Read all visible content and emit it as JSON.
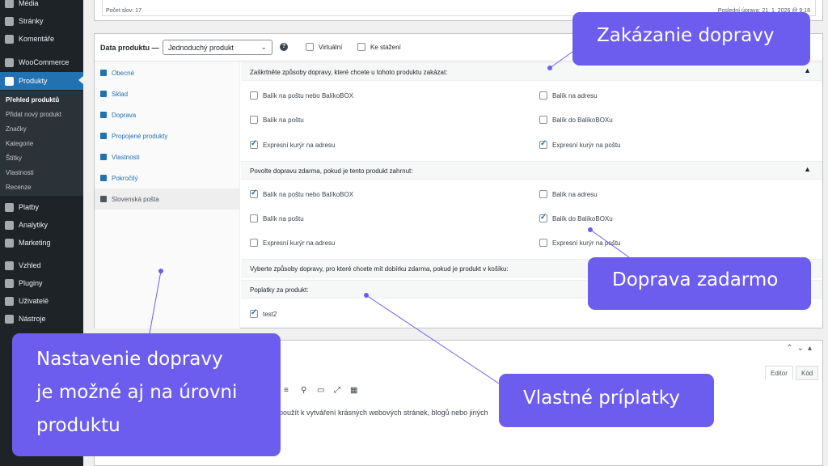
{
  "sidebar": {
    "items": [
      {
        "label": "Média",
        "icon": "media-icon"
      },
      {
        "label": "Stránky",
        "icon": "pages-icon"
      },
      {
        "label": "Komentáře",
        "icon": "comments-icon"
      },
      {
        "label": "WooCommerce",
        "icon": "woocommerce-icon"
      },
      {
        "label": "Produkty",
        "icon": "products-icon"
      },
      {
        "label": "Platby",
        "icon": "payments-icon"
      },
      {
        "label": "Analytiky",
        "icon": "analytics-icon"
      },
      {
        "label": "Marketing",
        "icon": "marketing-icon"
      },
      {
        "label": "Vzhled",
        "icon": "appearance-icon"
      },
      {
        "label": "Pluginy",
        "icon": "plugins-icon"
      },
      {
        "label": "Uživatelé",
        "icon": "users-icon"
      },
      {
        "label": "Nástroje",
        "icon": "tools-icon"
      }
    ],
    "submenu": [
      "Přehled produktů",
      "Přidat nový produkt",
      "Značky",
      "Kategorie",
      "Štítky",
      "Vlastnosti",
      "Recenze"
    ]
  },
  "editor_top": {
    "word_count": "Počet slov: 17",
    "last_edit": "Poslední úprava: 21. 1. 2026 @ 9:18"
  },
  "product_data": {
    "label": "Data produktu —",
    "type_select": "Jednoduchý produkt",
    "virtual_label": "Virtuální",
    "download_label": "Ke stažení",
    "tabs": [
      "Obecné",
      "Sklad",
      "Doprava",
      "Propojené produkty",
      "Vlastnosti",
      "Pokročilý",
      "Slovenská pošta"
    ]
  },
  "shipping_panel": {
    "section1_title": "Zaškrtněte způsoby dopravy, které chcete u tohoto produktu zakázat:",
    "section1_options": [
      {
        "label": "Balík na poštu nebo BalíkoBOX",
        "checked": false
      },
      {
        "label": "Balík na adresu",
        "checked": false
      },
      {
        "label": "Balík na poštu",
        "checked": false
      },
      {
        "label": "Balík do BalíkoBOXu",
        "checked": false
      },
      {
        "label": "Expresní kurýr na adresu",
        "checked": true
      },
      {
        "label": "Expresní kurýr na poštu",
        "checked": true
      }
    ],
    "section2_title": "Povolte dopravu zdarma, pokud je tento produkt zahrnut:",
    "section2_options": [
      {
        "label": "Balík na poštu nebo BalíkoBOX",
        "checked": true
      },
      {
        "label": "Balík na adresu",
        "checked": false
      },
      {
        "label": "Balík na poštu",
        "checked": false
      },
      {
        "label": "Balík do BalíkoBOXu",
        "checked": true
      },
      {
        "label": "Expresní kurýr na adresu",
        "checked": false
      },
      {
        "label": "Expresní kurýr na poštu",
        "checked": false
      }
    ],
    "section3_title": "Vyberte způsoby dopravy, pro které chcete mít dobírku zdarma, pokud je produkt v košíku:",
    "section4_title": "Poplatky za produkt:",
    "fee_option": {
      "label": "test2",
      "checked": true
    }
  },
  "editor_bottom": {
    "tab_editor": "Editor",
    "tab_code": "Kód",
    "text": "použít k vytváření krásných webových stránek, blogů nebo jiných"
  },
  "callouts": {
    "c1": "Zakázanie dopravy",
    "c2": "Doprava zadarmo",
    "c3": "Vlastné príplatky",
    "c4_lines": [
      "Nastavenie dopravy",
      "je možné aj na úrovni",
      "produktu"
    ]
  },
  "colors": {
    "callout": "#6d5dee",
    "sidebar": "#1d2327",
    "accent": "#2271b1"
  }
}
